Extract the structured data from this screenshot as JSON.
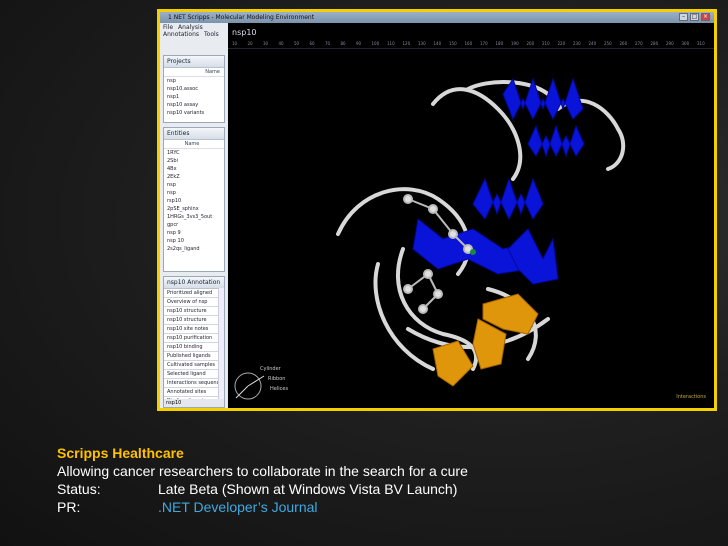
{
  "window": {
    "title": "1 NET Scripps - Molecular Modeling Environment"
  },
  "menu": [
    "File",
    "Analysis",
    "Annotations",
    "Tools"
  ],
  "projects": {
    "header": "Projects",
    "column": "Name",
    "items": [
      "nsp",
      "nsp10.assoc",
      "nsp1",
      "nsp10 assay",
      "nsp10 variants"
    ]
  },
  "entities": {
    "header": "Entities",
    "column": "Name",
    "items": [
      "1RYC",
      "2Sbi",
      "4Bx",
      "2EkZ",
      "nsp",
      "nsp",
      "rsp10",
      "2pSE_sphinx",
      "1HRGs_3vs3_5out",
      "gpcr",
      "nsp 9",
      "nsp 10",
      "2s2qs_ligand"
    ]
  },
  "annotations": {
    "header": "nsp10 Annotation",
    "column": "Note",
    "items": [
      "Prioritized aligned",
      "Overview of nsp",
      "nsp10 structure",
      "nsp10 structure",
      "nsp10 site notes",
      "nsp10 purification",
      "nsp10 binding",
      "Published ligands",
      "Cultivated samples",
      "Selected ligand",
      "Interactions sequence",
      "Annotated sites",
      "Binding domain"
    ],
    "footer": "nsp10"
  },
  "viewer": {
    "tab": "nsp10",
    "ruler": [
      "10",
      "20",
      "30",
      "40",
      "50",
      "60",
      "70",
      "80",
      "90",
      "100",
      "110",
      "120",
      "130",
      "140",
      "150",
      "160",
      "170",
      "180",
      "190",
      "200",
      "210",
      "220",
      "230",
      "240",
      "250",
      "260",
      "270",
      "280",
      "290",
      "300",
      "310"
    ],
    "watermark": "Interactions"
  },
  "axis_widget": {
    "labels": [
      "Cylinder",
      "Ribbon",
      "Helices"
    ]
  },
  "caption": {
    "title": "Scripps Healthcare",
    "line1": "Allowing cancer researchers to collaborate in the search for a cure",
    "status_key": "Status:",
    "status_val": "Late Beta (Shown at Windows Vista BV Launch)",
    "pr_key": "PR:",
    "pr_val": ".NET Developer’s Journal"
  },
  "colors": {
    "frame": "#f4d000",
    "helix": "#0a14d8",
    "sheet": "#e0960a",
    "coil": "#d8d8d8",
    "title": "#ffc000",
    "link": "#3fa9e0"
  }
}
